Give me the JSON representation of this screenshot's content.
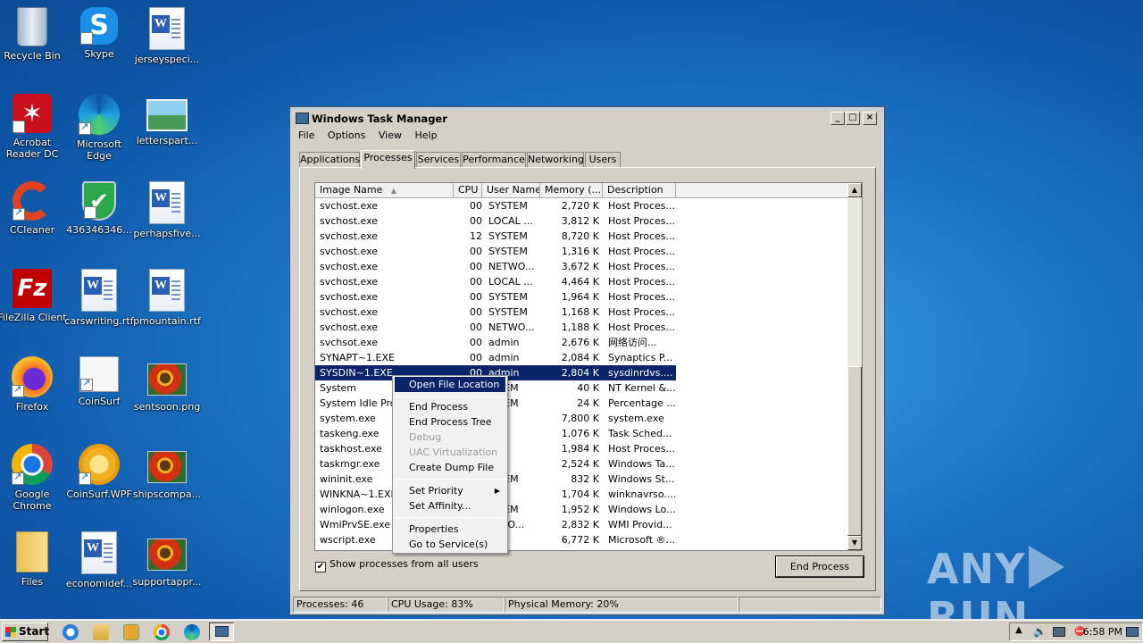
{
  "desktop": {
    "icons": [
      {
        "label": "Recycle Bin",
        "icon": "recycle-bin-icon"
      },
      {
        "label": "Skype",
        "icon": "skype-icon"
      },
      {
        "label": "jerseyspeci...",
        "icon": "word-doc-icon"
      },
      {
        "label": "Acrobat Reader DC",
        "icon": "acrobat-icon"
      },
      {
        "label": "Microsoft Edge",
        "icon": "edge-icon"
      },
      {
        "label": "letterspart...",
        "icon": "image-file-icon"
      },
      {
        "label": "CCleaner",
        "icon": "ccleaner-icon"
      },
      {
        "label": "436346346...",
        "icon": "shield-check-icon"
      },
      {
        "label": "perhapsfive...",
        "icon": "word-doc-icon"
      },
      {
        "label": "FileZilla Client",
        "icon": "filezilla-icon"
      },
      {
        "label": "carswriting.rtf",
        "icon": "word-doc-icon"
      },
      {
        "label": "pmountain.rtf",
        "icon": "word-doc-icon"
      },
      {
        "label": "Firefox",
        "icon": "firefox-icon"
      },
      {
        "label": "CoinSurf",
        "icon": "coinsurf-icon"
      },
      {
        "label": "sentsoon.png",
        "icon": "image-file-icon"
      },
      {
        "label": "Google Chrome",
        "icon": "chrome-icon"
      },
      {
        "label": "CoinSurf.WPF",
        "icon": "coinsurf-wpf-icon"
      },
      {
        "label": "shipscompa...",
        "icon": "image-file-icon"
      },
      {
        "label": "Files",
        "icon": "folder-icon"
      },
      {
        "label": "economidef...",
        "icon": "word-doc-icon"
      },
      {
        "label": "supportappr...",
        "icon": "image-file-icon"
      }
    ]
  },
  "window": {
    "title": "Windows Task Manager",
    "controls": {
      "minimize": "_",
      "maximize": "□",
      "close": "×"
    },
    "menu": [
      "File",
      "Options",
      "View",
      "Help"
    ],
    "tabs": [
      "Applications",
      "Processes",
      "Services",
      "Performance",
      "Networking",
      "Users"
    ],
    "active_tab": "Processes",
    "columns": [
      "Image Name",
      "CPU",
      "User Name",
      "Memory (...",
      "Description"
    ],
    "rows": [
      [
        "svchost.exe",
        "00",
        "SYSTEM",
        "2,720 K",
        "Host Proces..."
      ],
      [
        "svchost.exe",
        "00",
        "LOCAL ...",
        "3,812 K",
        "Host Proces..."
      ],
      [
        "svchost.exe",
        "12",
        "SYSTEM",
        "8,720 K",
        "Host Proces..."
      ],
      [
        "svchost.exe",
        "00",
        "SYSTEM",
        "1,316 K",
        "Host Proces..."
      ],
      [
        "svchost.exe",
        "00",
        "NETWO...",
        "3,672 K",
        "Host Proces..."
      ],
      [
        "svchost.exe",
        "00",
        "LOCAL ...",
        "4,464 K",
        "Host Proces..."
      ],
      [
        "svchost.exe",
        "00",
        "SYSTEM",
        "1,964 K",
        "Host Proces..."
      ],
      [
        "svchost.exe",
        "00",
        "SYSTEM",
        "1,168 K",
        "Host Proces..."
      ],
      [
        "svchost.exe",
        "00",
        "NETWO...",
        "1,188 K",
        "Host Proces..."
      ],
      [
        "svchsot.exe",
        "00",
        "admin",
        "2,676 K",
        "网络访问..."
      ],
      [
        "SYNAPT~1.EXE",
        "00",
        "admin",
        "2,084 K",
        "Synaptics P..."
      ],
      [
        "SYSDIN~1.EXE",
        "00",
        "admin",
        "2,804 K",
        "sysdinrdvs...."
      ],
      [
        "System",
        "",
        "...TEM",
        "40 K",
        "NT Kernel &..."
      ],
      [
        "System Idle Proc...",
        "",
        "...TEM",
        "24 K",
        "Percentage ..."
      ],
      [
        "system.exe",
        "",
        "...n",
        "7,800 K",
        "system.exe"
      ],
      [
        "taskeng.exe",
        "",
        "...n",
        "1,076 K",
        "Task Sched..."
      ],
      [
        "taskhost.exe",
        "",
        "...n",
        "1,984 K",
        "Host Proces..."
      ],
      [
        "taskmgr.exe",
        "",
        "...n",
        "2,524 K",
        "Windows Ta..."
      ],
      [
        "wininit.exe",
        "",
        "...TEM",
        "832 K",
        "Windows St..."
      ],
      [
        "WINKNA~1.EXE",
        "",
        "...n",
        "1,704 K",
        "winknavrso...."
      ],
      [
        "winlogon.exe",
        "",
        "...TEM",
        "1,952 K",
        "Windows Lo..."
      ],
      [
        "WmiPrvSE.exe",
        "",
        "...WO...",
        "2,832 K",
        "WMI Provid..."
      ],
      [
        "wscript.exe",
        "",
        "...n",
        "6,772 K",
        "Microsoft ®..."
      ]
    ],
    "selected_row_index": 11,
    "show_all_label": "Show processes from all users",
    "show_all_checked": true,
    "end_process_label": "End Process",
    "status": {
      "processes": "Processes: 46",
      "cpu": "CPU Usage: 83%",
      "memory": "Physical Memory: 20%"
    }
  },
  "context_menu": {
    "items": [
      {
        "label": "Open File Location",
        "state": "highlighted"
      },
      {
        "label": "End Process",
        "state": "normal"
      },
      {
        "label": "End Process Tree",
        "state": "normal"
      },
      {
        "label": "Debug",
        "state": "disabled"
      },
      {
        "label": "UAC Virtualization",
        "state": "disabled"
      },
      {
        "label": "Create Dump File",
        "state": "normal"
      },
      {
        "label": "Set Priority",
        "state": "normal",
        "submenu": true
      },
      {
        "label": "Set Affinity...",
        "state": "normal"
      },
      {
        "label": "Properties",
        "state": "normal"
      },
      {
        "label": "Go to Service(s)",
        "state": "normal"
      }
    ]
  },
  "taskbar": {
    "start_label": "Start",
    "clock": "6:58 PM",
    "pinned": [
      "ie-icon",
      "explorer-icon",
      "media-player-icon",
      "chrome-icon",
      "edge-icon",
      "task-manager-icon"
    ]
  },
  "watermark": {
    "left": "ANY",
    "right": "RUN"
  }
}
